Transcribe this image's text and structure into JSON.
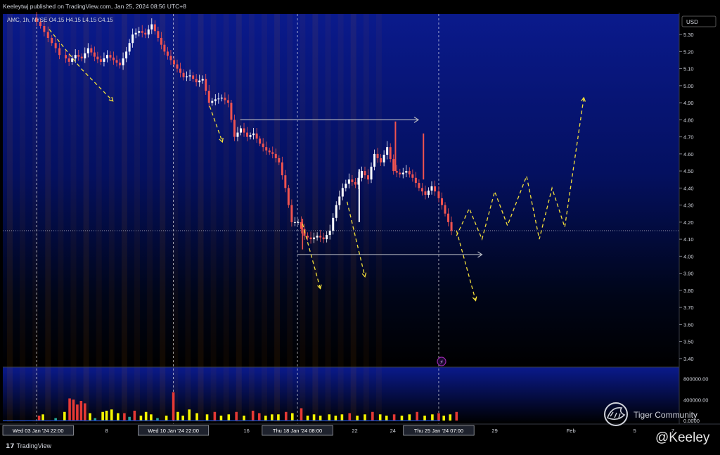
{
  "header": {
    "published": "Keeleytwj published on TradingView.com, Jan 25, 2024 08:56 UTC+8",
    "legend": "AMC, 1h, NYSE  O4.15  H4.15  L4.15  C4.15"
  },
  "footer": {
    "brand": "TradingView",
    "watermark": "Tiger Community",
    "handle": "@Keeley"
  },
  "colors": {
    "background_top": "#0a1a8c",
    "background_bottom": "#000000",
    "up_candle": "#ffffff",
    "down_candle": "#ef5350",
    "projection": "#f5e13a",
    "range_box": "#b2b5be",
    "volume_red": "#e53935",
    "volume_yellow": "#f5f500",
    "volume_green": "#26a69a"
  },
  "chart_data": {
    "type": "candlestick",
    "symbol": "AMC",
    "interval": "1h",
    "exchange": "NYSE",
    "currency": "USD",
    "last_price": 4.15,
    "ylim": [
      3.35,
      5.42
    ],
    "y_ticks": [
      "5.30",
      "5.20",
      "5.10",
      "5.00",
      "4.90",
      "4.80",
      "4.70",
      "4.60",
      "4.50",
      "4.40",
      "4.30",
      "4.20",
      "4.10",
      "4.00",
      "3.90",
      "3.80",
      "3.70",
      "3.60",
      "3.50",
      "3.40"
    ],
    "volume_ticks": [
      "800000.00",
      "400000.00",
      "0.0000"
    ],
    "x_labels": [
      {
        "label": "Wed 03 Jan '24  22:00",
        "x": 0.0,
        "boxed": true
      },
      {
        "label": "8",
        "x": 5.5,
        "boxed": false
      },
      {
        "label": "Wed 10 Jan '24  22:00",
        "x": 10.75,
        "boxed": true
      },
      {
        "label": "16",
        "x": 16.5,
        "boxed": false
      },
      {
        "label": "Thu 18 Jan '24  08:00",
        "x": 20.5,
        "boxed": true
      },
      {
        "label": "22",
        "x": 25.0,
        "boxed": false
      },
      {
        "label": "24",
        "x": 28.0,
        "boxed": false
      },
      {
        "label": "Thu 25 Jan '24  07:00",
        "x": 31.6,
        "boxed": true
      },
      {
        "label": "29",
        "x": 36.0,
        "boxed": false
      },
      {
        "label": "Feb",
        "x": 42.0,
        "boxed": false
      },
      {
        "label": "5",
        "x": 47.0,
        "boxed": false
      },
      {
        "label": "7",
        "x": 50.0,
        "boxed": false
      }
    ],
    "session_lines_x": [
      0.0,
      10.75,
      20.5,
      31.6
    ],
    "price_series": [
      [
        0.0,
        5.4
      ],
      [
        0.6,
        5.35
      ],
      [
        1.2,
        5.28
      ],
      [
        1.8,
        5.22
      ],
      [
        2.3,
        5.18
      ],
      [
        2.8,
        5.14
      ],
      [
        3.3,
        5.18
      ],
      [
        3.8,
        5.16
      ],
      [
        4.3,
        5.22
      ],
      [
        4.8,
        5.17
      ],
      [
        5.3,
        5.14
      ],
      [
        5.8,
        5.18
      ],
      [
        6.3,
        5.15
      ],
      [
        6.8,
        5.12
      ],
      [
        7.3,
        5.2
      ],
      [
        7.8,
        5.3
      ],
      [
        8.3,
        5.32
      ],
      [
        8.8,
        5.3
      ],
      [
        9.3,
        5.36
      ],
      [
        9.8,
        5.28
      ],
      [
        10.3,
        5.2
      ],
      [
        10.8,
        5.15
      ],
      [
        11.3,
        5.1
      ],
      [
        11.8,
        5.05
      ],
      [
        12.3,
        5.06
      ],
      [
        12.8,
        5.02
      ],
      [
        13.3,
        5.04
      ],
      [
        13.8,
        4.9
      ],
      [
        14.3,
        4.92
      ],
      [
        14.8,
        4.93
      ],
      [
        15.3,
        4.9
      ],
      [
        15.8,
        4.7
      ],
      [
        16.3,
        4.75
      ],
      [
        16.8,
        4.7
      ],
      [
        17.3,
        4.72
      ],
      [
        17.8,
        4.66
      ],
      [
        18.3,
        4.62
      ],
      [
        18.8,
        4.6
      ],
      [
        19.3,
        4.55
      ],
      [
        19.8,
        4.4
      ],
      [
        20.3,
        4.2
      ],
      [
        20.8,
        4.2
      ],
      [
        21.3,
        4.12
      ],
      [
        21.8,
        4.1
      ],
      [
        22.3,
        4.12
      ],
      [
        22.8,
        4.1
      ],
      [
        23.3,
        4.15
      ],
      [
        23.8,
        4.3
      ],
      [
        24.3,
        4.4
      ],
      [
        24.8,
        4.45
      ],
      [
        25.3,
        4.42
      ],
      [
        25.8,
        4.5
      ],
      [
        26.3,
        4.45
      ],
      [
        26.8,
        4.6
      ],
      [
        27.3,
        4.55
      ],
      [
        27.8,
        4.64
      ],
      [
        28.3,
        4.5
      ],
      [
        28.8,
        4.48
      ],
      [
        29.3,
        4.5
      ],
      [
        29.8,
        4.46
      ],
      [
        30.3,
        4.4
      ],
      [
        30.8,
        4.36
      ],
      [
        31.3,
        4.41
      ],
      [
        31.6,
        4.38
      ],
      [
        32.1,
        4.3
      ],
      [
        32.6,
        4.2
      ],
      [
        33.0,
        4.15
      ]
    ],
    "range_box": [
      {
        "x0": 16.0,
        "x1": 30.0,
        "y": 4.8
      },
      {
        "x0": 20.5,
        "x1": 35.0,
        "y": 4.01
      }
    ],
    "projection_paths": [
      [
        [
          1.0,
          5.33
        ],
        [
          3.5,
          5.1
        ],
        [
          6.0,
          4.91
        ]
      ],
      [
        [
          13.6,
          4.88
        ],
        [
          14.6,
          4.67
        ]
      ],
      [
        [
          20.9,
          4.19
        ],
        [
          22.3,
          3.81
        ]
      ],
      [
        [
          24.4,
          4.32
        ],
        [
          25.8,
          3.88
        ]
      ],
      [
        [
          33.0,
          4.15
        ],
        [
          34.5,
          3.74
        ]
      ],
      [
        [
          33.0,
          4.12
        ],
        [
          34.0,
          4.28
        ],
        [
          35.0,
          4.1
        ],
        [
          36.0,
          4.38
        ],
        [
          37.0,
          4.18
        ],
        [
          38.5,
          4.47
        ],
        [
          39.5,
          4.1
        ],
        [
          40.5,
          4.4
        ],
        [
          41.5,
          4.17
        ],
        [
          43.0,
          4.93
        ]
      ]
    ],
    "volume": [
      [
        0.2,
        0.2,
        "red"
      ],
      [
        0.5,
        0.25,
        "yellow"
      ],
      [
        1.5,
        0.1,
        "green"
      ],
      [
        2.2,
        0.35,
        "yellow"
      ],
      [
        2.6,
        0.9,
        "red"
      ],
      [
        2.9,
        0.85,
        "red"
      ],
      [
        3.2,
        0.65,
        "red"
      ],
      [
        3.5,
        0.8,
        "red"
      ],
      [
        3.8,
        0.7,
        "red"
      ],
      [
        4.2,
        0.3,
        "yellow"
      ],
      [
        4.6,
        0.1,
        "green"
      ],
      [
        5.2,
        0.35,
        "yellow"
      ],
      [
        5.5,
        0.4,
        "yellow"
      ],
      [
        5.9,
        0.45,
        "yellow"
      ],
      [
        6.4,
        0.3,
        "yellow"
      ],
      [
        6.9,
        0.3,
        "red"
      ],
      [
        7.3,
        0.15,
        "green"
      ],
      [
        7.7,
        0.4,
        "red"
      ],
      [
        8.2,
        0.2,
        "yellow"
      ],
      [
        8.6,
        0.35,
        "yellow"
      ],
      [
        9.0,
        0.25,
        "yellow"
      ],
      [
        9.5,
        0.1,
        "green"
      ],
      [
        10.2,
        0.2,
        "yellow"
      ],
      [
        10.75,
        1.15,
        "red"
      ],
      [
        11.1,
        0.35,
        "yellow"
      ],
      [
        11.5,
        0.2,
        "yellow"
      ],
      [
        12.0,
        0.45,
        "yellow"
      ],
      [
        12.6,
        0.3,
        "yellow"
      ],
      [
        13.4,
        0.25,
        "yellow"
      ],
      [
        14.0,
        0.35,
        "red"
      ],
      [
        14.5,
        0.2,
        "yellow"
      ],
      [
        15.1,
        0.25,
        "yellow"
      ],
      [
        15.7,
        0.35,
        "red"
      ],
      [
        16.3,
        0.2,
        "yellow"
      ],
      [
        17.0,
        0.4,
        "red"
      ],
      [
        17.5,
        0.3,
        "red"
      ],
      [
        18.0,
        0.2,
        "yellow"
      ],
      [
        18.5,
        0.25,
        "yellow"
      ],
      [
        19.0,
        0.25,
        "yellow"
      ],
      [
        19.6,
        0.35,
        "red"
      ],
      [
        20.1,
        0.3,
        "yellow"
      ],
      [
        20.8,
        0.5,
        "red"
      ],
      [
        21.3,
        0.2,
        "yellow"
      ],
      [
        21.8,
        0.25,
        "yellow"
      ],
      [
        22.3,
        0.2,
        "yellow"
      ],
      [
        23.0,
        0.25,
        "yellow"
      ],
      [
        23.5,
        0.2,
        "yellow"
      ],
      [
        24.0,
        0.25,
        "yellow"
      ],
      [
        24.6,
        0.3,
        "red"
      ],
      [
        25.2,
        0.2,
        "yellow"
      ],
      [
        25.8,
        0.25,
        "yellow"
      ],
      [
        26.4,
        0.35,
        "red"
      ],
      [
        27.0,
        0.25,
        "yellow"
      ],
      [
        27.5,
        0.2,
        "yellow"
      ],
      [
        28.1,
        0.25,
        "red"
      ],
      [
        28.7,
        0.2,
        "yellow"
      ],
      [
        29.3,
        0.25,
        "yellow"
      ],
      [
        29.9,
        0.35,
        "red"
      ],
      [
        30.5,
        0.2,
        "yellow"
      ],
      [
        31.1,
        0.25,
        "yellow"
      ],
      [
        31.6,
        0.3,
        "red"
      ],
      [
        32.0,
        0.2,
        "yellow"
      ],
      [
        32.5,
        0.25,
        "yellow"
      ],
      [
        33.0,
        0.35,
        "red"
      ]
    ]
  }
}
